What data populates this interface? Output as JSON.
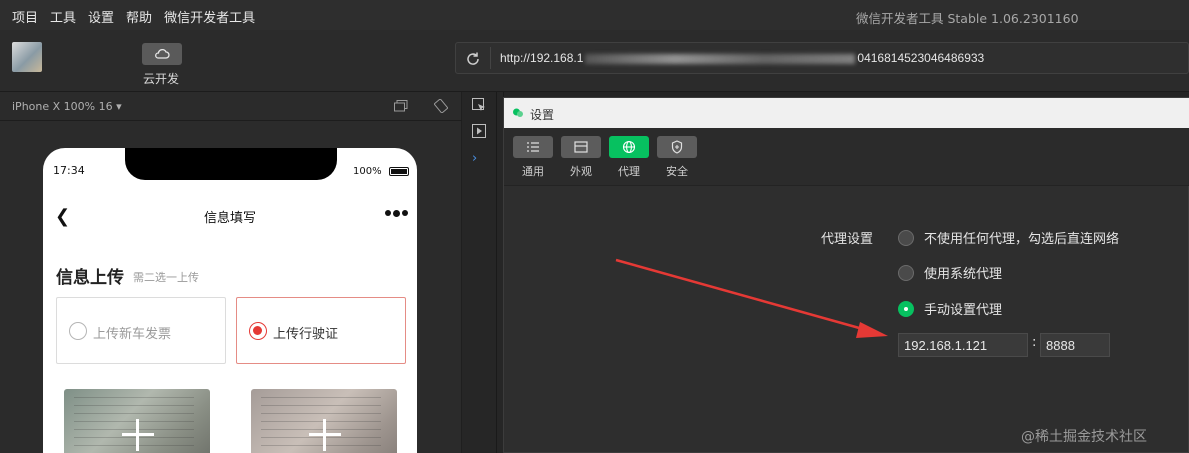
{
  "menubar": {
    "items": [
      "项目",
      "工具",
      "设置",
      "帮助",
      "微信开发者工具"
    ],
    "window_title": "微信开发者工具 Stable 1.06.2301160"
  },
  "toolbar": {
    "cloud_label": "云开发",
    "url_prefix": "http://192.168.1",
    "url_suffix": "0416814523046486933"
  },
  "simulator": {
    "device_label": "iPhone X 100% 16 ▾",
    "status_time": "17:34",
    "battery_text": "100%",
    "nav_title": "信息填写",
    "section_title": "信息上传",
    "section_subtitle": "需二选一上传",
    "options": [
      "上传新车发票",
      "上传行驶证"
    ],
    "selected_option": 1
  },
  "settings_dialog": {
    "title": "设置",
    "tabs": [
      {
        "label": "通用",
        "icon": "list-icon"
      },
      {
        "label": "外观",
        "icon": "layout-icon"
      },
      {
        "label": "代理",
        "icon": "globe-icon"
      },
      {
        "label": "安全",
        "icon": "shield-icon"
      }
    ],
    "active_tab": 2,
    "proxy_label": "代理设置",
    "proxy_options": [
      "不使用任何代理，勾选后直连网络",
      "使用系统代理",
      "手动设置代理"
    ],
    "selected_proxy": 2,
    "host_value": "192.168.1.121",
    "port_value": "8888"
  },
  "watermark": "@稀土掘金技术社区",
  "colors": {
    "accent_green": "#07c160",
    "annotation_red": "#e53935"
  }
}
